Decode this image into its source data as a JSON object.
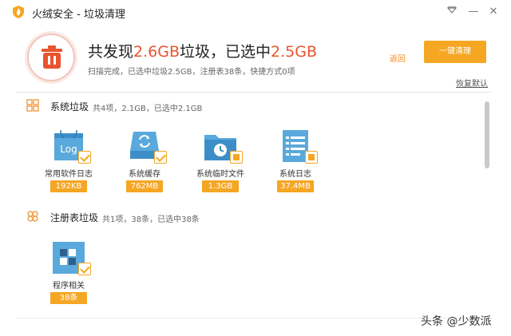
{
  "app": {
    "title": "火绒安全 - 垃圾清理",
    "brand_color": "#f5a623",
    "accent_red": "#e8542e"
  },
  "titlebar": {
    "skin_icon": "triangle-down-icon",
    "minimize": "—",
    "close": "✕"
  },
  "summary": {
    "prefix": "共发现",
    "found_size": "2.6GB",
    "mid": "垃圾，已选中",
    "selected_size": "2.5GB",
    "status": "扫描完成，已选中垃圾2.5GB，注册表38条，快捷方式0项",
    "back_label": "返回",
    "clean_label": "一键清理",
    "restore_label": "恢复默认"
  },
  "sections": {
    "system": {
      "title": "系统垃圾",
      "sub": "共4项，2.1GB，已选中2.1GB",
      "items": [
        {
          "label": "常用软件日志",
          "size": "192KB",
          "icon": "log-folder-icon",
          "state": "checked"
        },
        {
          "label": "系统缓存",
          "size": "762MB",
          "icon": "refresh-drive-icon",
          "state": "checked"
        },
        {
          "label": "系统临时文件",
          "size": "1.3GB",
          "icon": "clock-folder-icon",
          "state": "partial"
        },
        {
          "label": "系统日志",
          "size": "37.4MB",
          "icon": "document-icon",
          "state": "partial"
        }
      ]
    },
    "registry": {
      "title": "注册表垃圾",
      "sub": "共1项，38条，已选中38条",
      "items": [
        {
          "label": "程序相关",
          "size": "38条",
          "icon": "registry-blocks-icon",
          "state": "checked"
        }
      ]
    }
  },
  "watermark": "头条 @少数派"
}
